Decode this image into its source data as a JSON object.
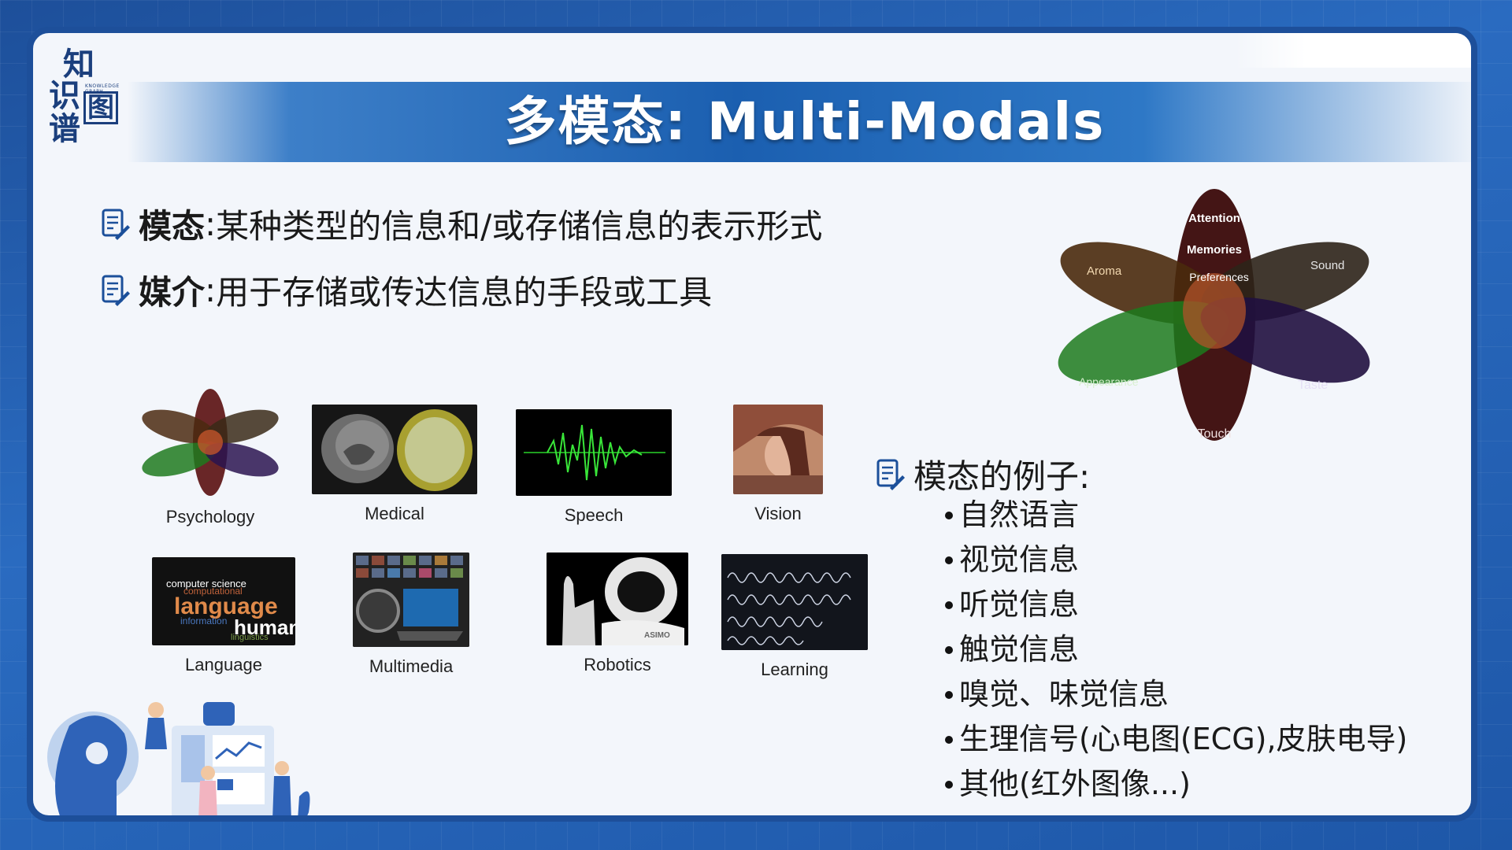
{
  "logo": {
    "chars": [
      "知",
      "识",
      "图",
      "谱"
    ],
    "tagline": "KNOWLEDGE GRAPH"
  },
  "title": "多模态: Multi-Modals",
  "definitions": [
    {
      "term": "模态",
      "sep": ":",
      "text": "某种类型的信息和/或存储信息的表示形式"
    },
    {
      "term": "媒介",
      "sep": ":",
      "text": "用于存储或传达信息的手段或工具"
    }
  ],
  "tiles": [
    {
      "caption": "Psychology"
    },
    {
      "caption": "Medical"
    },
    {
      "caption": "Speech"
    },
    {
      "caption": "Vision"
    },
    {
      "caption": "Language"
    },
    {
      "caption": "Multimedia"
    },
    {
      "caption": "Robotics"
    },
    {
      "caption": "Learning"
    }
  ],
  "language_tile_words": {
    "w1": "computer science",
    "w2": "computational",
    "w3": "language",
    "w4": "information",
    "w5": "human",
    "w6": "linguistics"
  },
  "robot_label": "ASIMO",
  "flower": {
    "petals": [
      "Attention",
      "Memories",
      "Preferences",
      "Aroma",
      "Sound",
      "Appearance",
      "Taste",
      "Touch"
    ]
  },
  "examples": {
    "heading": "模态的例子:",
    "items": [
      "自然语言",
      "视觉信息",
      "听觉信息",
      "触觉信息",
      "嗅觉、味觉信息",
      "生理信号(心电图(ECG),皮肤电导)",
      "其他(红外图像...)"
    ]
  },
  "colors": {
    "frame": "#1d4f9a",
    "title_band": "#1b5fb0",
    "slide_bg": "#f3f6fb"
  },
  "icons": [
    "note-pen-icon",
    "bullet-dot-icon"
  ]
}
